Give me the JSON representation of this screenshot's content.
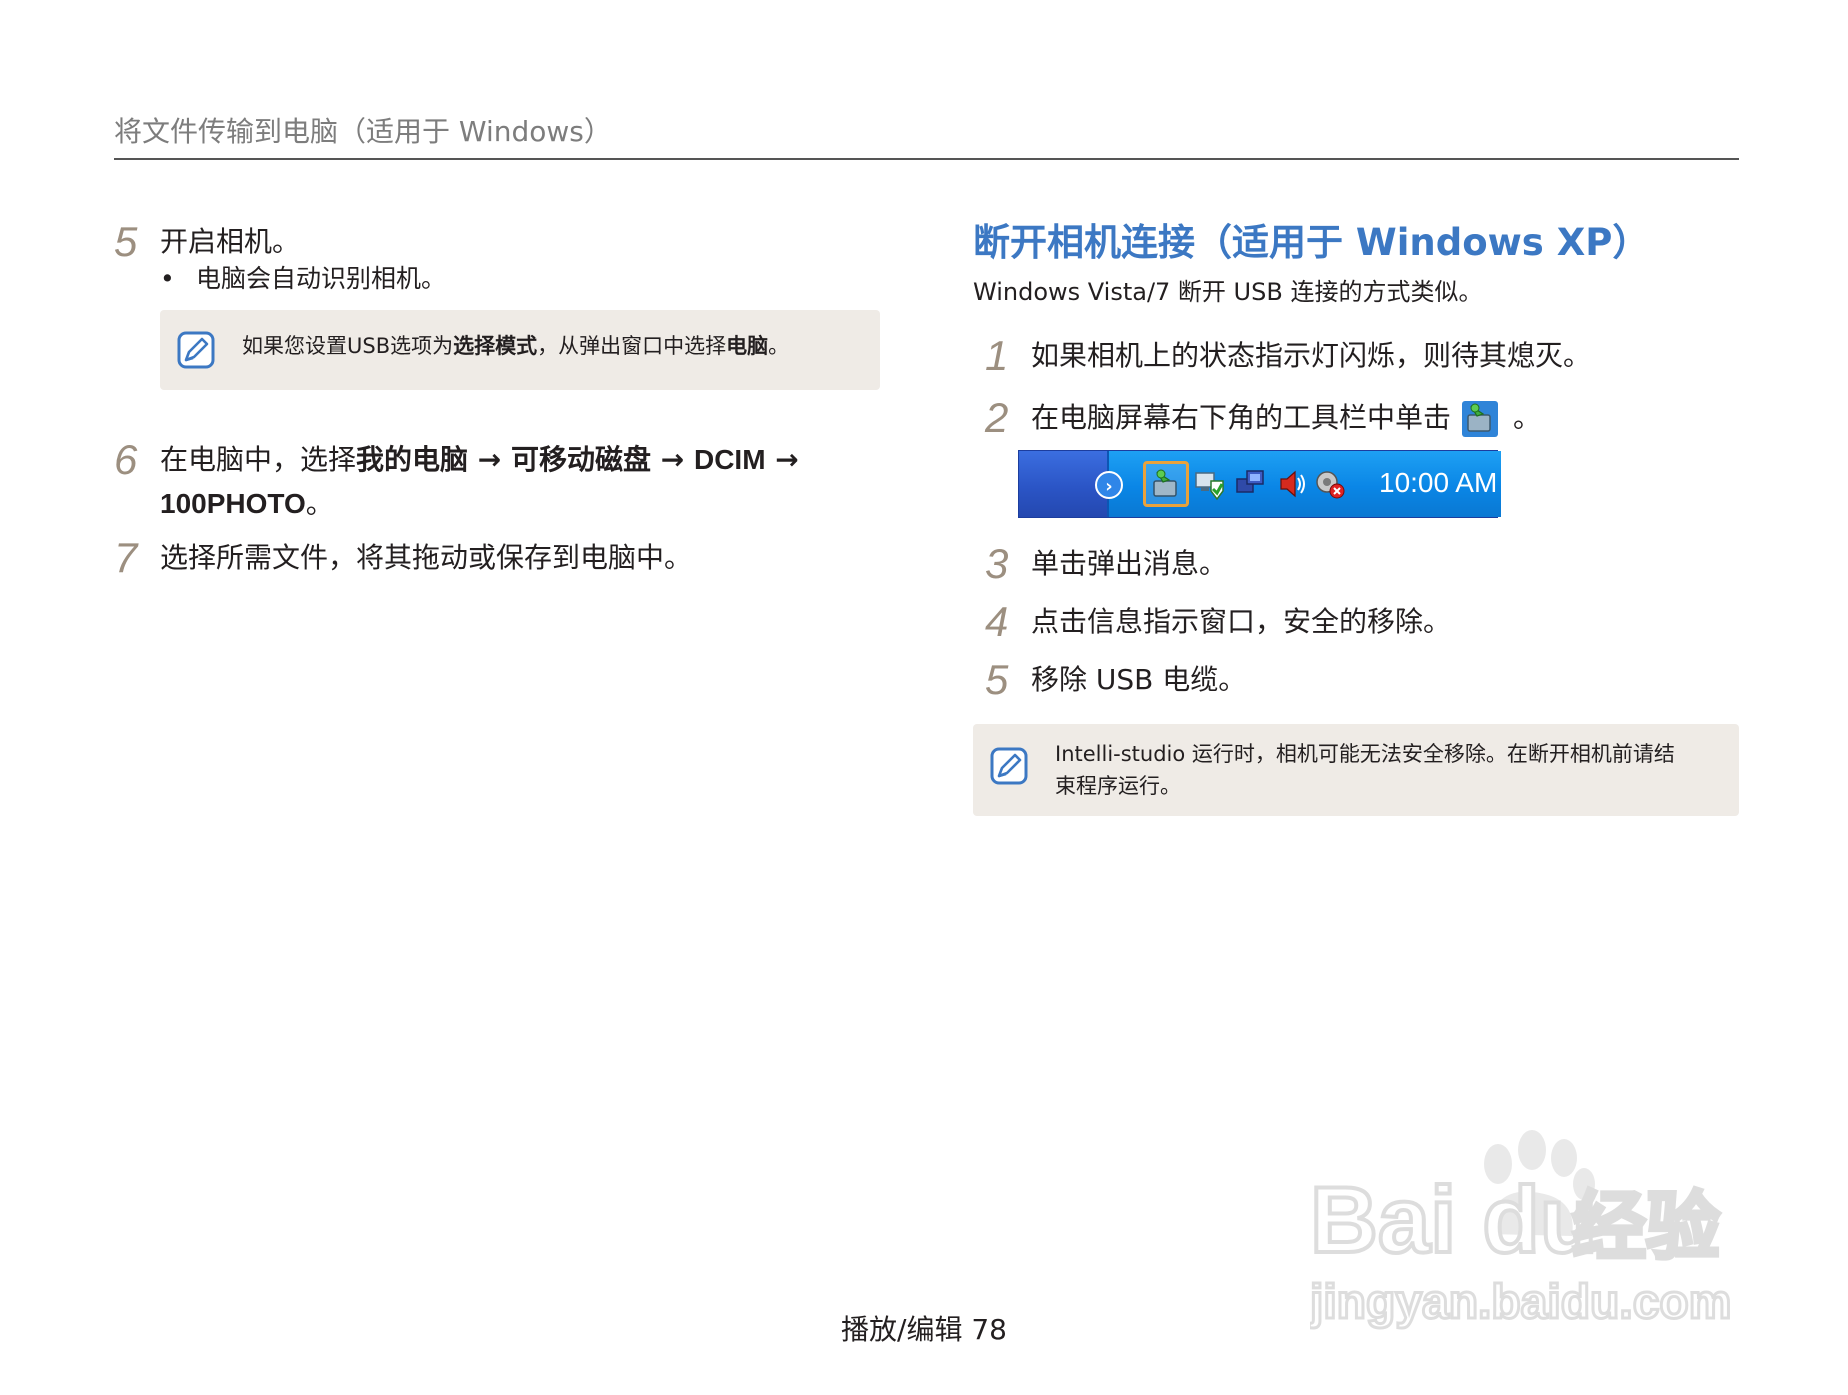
{
  "header": {
    "title": "将文件传输到电脑（适用于 Windows）"
  },
  "left": {
    "step5": {
      "num": "5",
      "text": "开启相机。"
    },
    "bullet": {
      "dot": "•",
      "text": "电脑会自动识别相机。"
    },
    "note1": {
      "icon": "note-pencil-icon",
      "pre": "如果您设置USB选项为",
      "bold1": "选择模式",
      "mid": "，从弹出窗口中选择",
      "bold2": "电脑",
      "post": "。"
    },
    "step6": {
      "num": "6",
      "pre": "在电脑中，选择",
      "b1": "我的电脑",
      "arrow1": " → ",
      "b2": "可移动磁盘",
      "arrow2": " → ",
      "b3": "DCIM",
      "arrow3": " → ",
      "b4": "100PHOTO",
      "post": "。"
    },
    "step7": {
      "num": "7",
      "text": "选择所需文件，将其拖动或保存到电脑中。"
    }
  },
  "right": {
    "title": "断开相机连接（适用于 Windows XP）",
    "subtitle": "Windows Vista/7 断开 USB 连接的方式类似。",
    "steps": [
      {
        "num": "1",
        "text": "如果相机上的状态指示灯闪烁，则待其熄灭。"
      },
      {
        "num": "2",
        "text": "在电脑屏幕右下角的工具栏中单击",
        "post": "。",
        "icon": "safely-remove-hardware-icon"
      },
      {
        "num": "3",
        "text": "单击弹出消息。"
      },
      {
        "num": "4",
        "text": "点击信息指示窗口，安全的移除。"
      },
      {
        "num": "5",
        "text": "移除 USB 电缆。"
      }
    ],
    "taskbar": {
      "expand": "›",
      "icons": [
        "safely-remove-hardware-icon",
        "network-shield-icon",
        "network-icon",
        "volume-icon",
        "security-alert-icon"
      ],
      "clock": "10:00 AM"
    },
    "note2": {
      "icon": "note-pencil-icon",
      "line1": "Intelli-studio 运行时，相机可能无法安全移除。在断开相机前请结",
      "line2": "束程序运行。"
    }
  },
  "footer": {
    "text": "播放/编辑 78"
  },
  "watermark": {
    "brand": "Bai du",
    "cn": "经验",
    "url": "jingyan.baidu.com"
  },
  "colors": {
    "accent": "#3c78c3",
    "step_number": "#9c8f80",
    "note_bg": "#efebe6"
  }
}
